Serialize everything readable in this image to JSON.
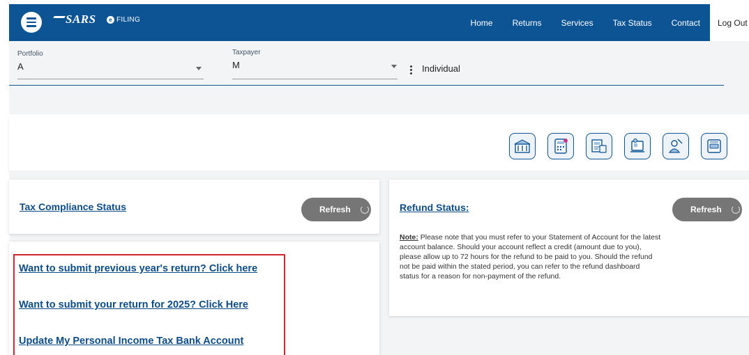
{
  "header": {
    "brand": "SARS",
    "efiling": "FILING",
    "nav": [
      "Home",
      "Returns",
      "Services",
      "Tax Status",
      "Contact"
    ],
    "logout": "Log Out"
  },
  "selector": {
    "portfolio_label": "Portfolio",
    "portfolio_value": "A",
    "taxpayer_label": "Taxpayer",
    "taxpayer_value": "M",
    "taxpayer_type": "Individual"
  },
  "service_icons": [
    "bank-building-icon",
    "calculator-icon",
    "document-card-icon",
    "laptop-person-icon",
    "help-person-icon",
    "payment-card-icon"
  ],
  "compliance": {
    "title": "Tax Compliance Status",
    "refresh": "Refresh"
  },
  "refund": {
    "title": "Refund Status:",
    "refresh": "Refresh",
    "note_label": "Note:",
    "note_text": " Please note that you must refer to your Statement of Account for the latest account balance. Should your account reflect a credit (amount due to you), please allow up to 72 hours for the refund to be paid to you. Should the refund not be paid within the stated period, you can refer to the refund dashboard status for a reason for non-payment of the refund."
  },
  "links": {
    "previous_year": "Want to submit previous year's return? Click here",
    "current_year": "Want to submit your return for 2025? Click Here",
    "bank_account": "Update My Personal Income Tax Bank Account"
  },
  "colors": {
    "brand_blue": "#0d5495",
    "link_blue": "#0d4c87",
    "highlight_red": "#d4232c",
    "refresh_gray": "#767676"
  }
}
